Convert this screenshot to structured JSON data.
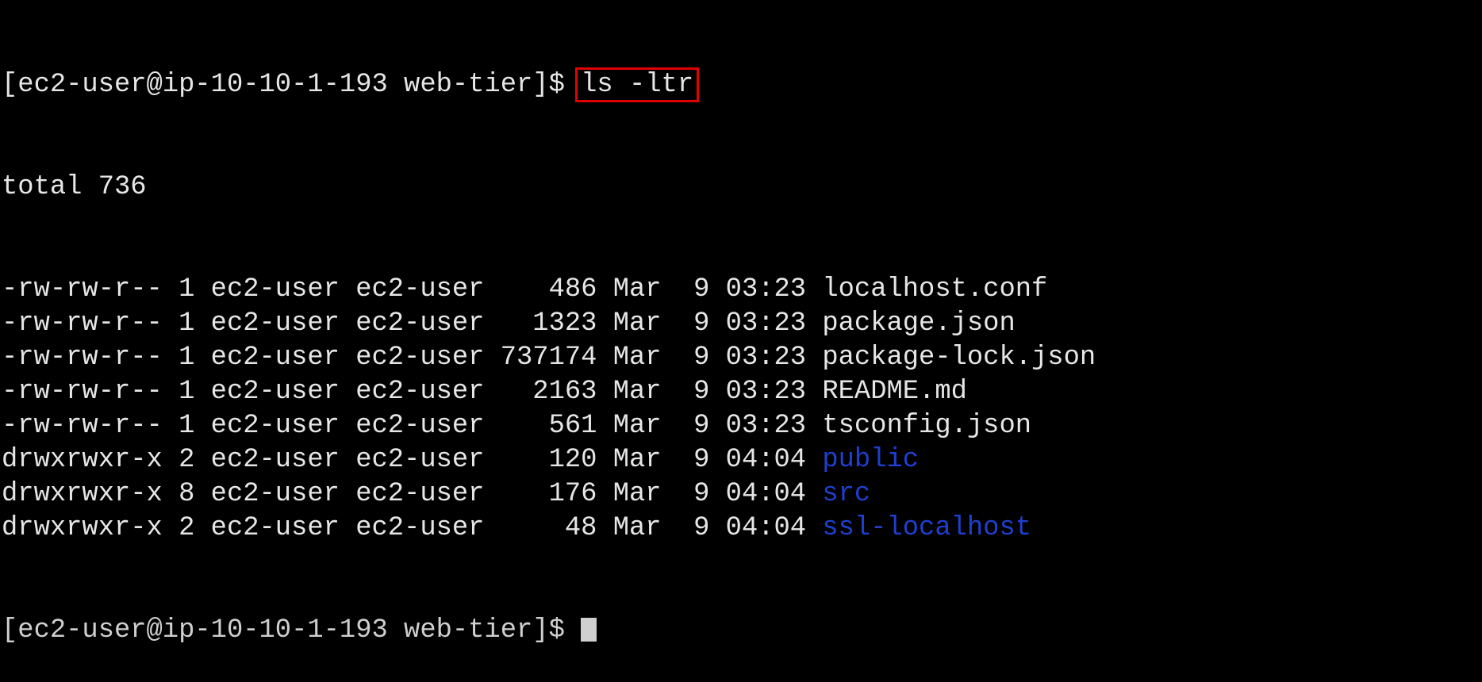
{
  "prompt": "[ec2-user@ip-10-10-1-193 web-tier]$ ",
  "command": "ls -ltr",
  "total": "total 736",
  "entries": [
    {
      "perms": "-rw-rw-r--",
      "links": "1",
      "owner": "ec2-user",
      "group": "ec2-user",
      "size": "486",
      "month": "Mar",
      "day": "9",
      "time": "03:23",
      "name": "localhost.conf",
      "type": "file"
    },
    {
      "perms": "-rw-rw-r--",
      "links": "1",
      "owner": "ec2-user",
      "group": "ec2-user",
      "size": "1323",
      "month": "Mar",
      "day": "9",
      "time": "03:23",
      "name": "package.json",
      "type": "file"
    },
    {
      "perms": "-rw-rw-r--",
      "links": "1",
      "owner": "ec2-user",
      "group": "ec2-user",
      "size": "737174",
      "month": "Mar",
      "day": "9",
      "time": "03:23",
      "name": "package-lock.json",
      "type": "file"
    },
    {
      "perms": "-rw-rw-r--",
      "links": "1",
      "owner": "ec2-user",
      "group": "ec2-user",
      "size": "2163",
      "month": "Mar",
      "day": "9",
      "time": "03:23",
      "name": "README.md",
      "type": "file"
    },
    {
      "perms": "-rw-rw-r--",
      "links": "1",
      "owner": "ec2-user",
      "group": "ec2-user",
      "size": "561",
      "month": "Mar",
      "day": "9",
      "time": "03:23",
      "name": "tsconfig.json",
      "type": "file"
    },
    {
      "perms": "drwxrwxr-x",
      "links": "2",
      "owner": "ec2-user",
      "group": "ec2-user",
      "size": "120",
      "month": "Mar",
      "day": "9",
      "time": "04:04",
      "name": "public",
      "type": "dir"
    },
    {
      "perms": "drwxrwxr-x",
      "links": "8",
      "owner": "ec2-user",
      "group": "ec2-user",
      "size": "176",
      "month": "Mar",
      "day": "9",
      "time": "04:04",
      "name": "src",
      "type": "dir"
    },
    {
      "perms": "drwxrwxr-x",
      "links": "2",
      "owner": "ec2-user",
      "group": "ec2-user",
      "size": "48",
      "month": "Mar",
      "day": "9",
      "time": "04:04",
      "name": "ssl-localhost",
      "type": "dir"
    }
  ],
  "colors": {
    "text": "#e6e6e6",
    "directory": "#1f3fd0",
    "highlight": "#e00000",
    "background": "#000000"
  }
}
